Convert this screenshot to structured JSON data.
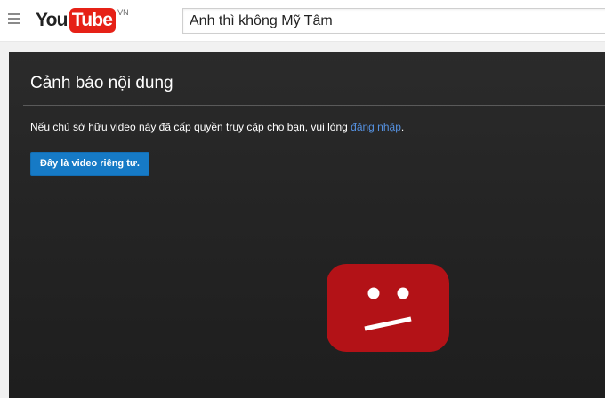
{
  "header": {
    "logo_you": "You",
    "logo_tube": "Tube",
    "logo_country": "VN",
    "search_value": "Anh thì không Mỹ Tâm"
  },
  "player": {
    "title": "Cảnh báo nội dung",
    "message_prefix": "Nếu chủ sở hữu video này đã cấp quyền truy cập cho bạn, vui lòng ",
    "login_link": "đăng nhập",
    "message_suffix": ".",
    "private_button": "Đây là video riêng tư."
  },
  "colors": {
    "brand_red": "#e62117",
    "link_blue": "#5591e0",
    "button_blue": "#167ac6",
    "sad_icon_red": "#b31217"
  },
  "icons": {
    "menu": "hamburger-menu-icon",
    "error": "sad-tv-icon"
  }
}
